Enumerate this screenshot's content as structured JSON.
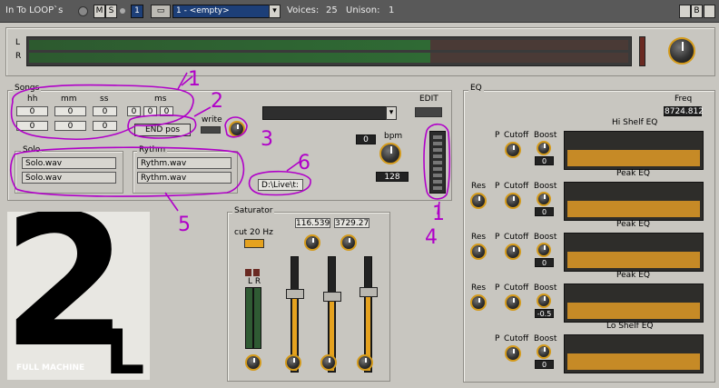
{
  "titlebar": {
    "device_name": "In To LOOP`s",
    "m_label": "M",
    "s_label": "S",
    "channel": "1",
    "preset": "1 - <empty>",
    "voices_label": "Voices:",
    "voices_value": "25",
    "unison_label": "Unison:",
    "unison_value": "1",
    "b_label": "B"
  },
  "meter": {
    "l_label": "L",
    "r_label": "R",
    "level": 0.67
  },
  "songs": {
    "title": "Songs",
    "col_hh": "hh",
    "col_mm": "mm",
    "col_ss": "ss",
    "col_ms": "ms",
    "row1": [
      "0",
      "0",
      "0",
      "0",
      "0",
      "0"
    ],
    "row2": [
      "0",
      "0",
      "0"
    ],
    "end_pos": "END pos",
    "write": "write",
    "edit": "EDIT",
    "bpm_label": "bpm",
    "bpm_small": "0",
    "bpm_value": "128",
    "path": "D:\\Live\\t:"
  },
  "solo": {
    "title": "Solo",
    "items": [
      "Solo.wav",
      "Solo.wav"
    ]
  },
  "rythm": {
    "title": "Rythm",
    "items": [
      "Rythm.wav",
      "Rythm.wav"
    ]
  },
  "logo": {
    "big": "2",
    "small": "L",
    "caption": "FULL MACHINE"
  },
  "saturator": {
    "title": "Saturator",
    "cut_label": "cut 20 Hz",
    "val1": "116.539",
    "val2": "3729.27",
    "lr_label": "L R"
  },
  "eq": {
    "title": "EQ",
    "freq_label": "Freq",
    "freq_value": "8724.812",
    "bands": [
      {
        "name": "Hi Shelf EQ",
        "res": "",
        "p": "P",
        "cutoff": "Cutoff",
        "boost": "Boost",
        "boost_val": "0"
      },
      {
        "name": "Peak EQ",
        "res": "Res",
        "p": "P",
        "cutoff": "Cutoff",
        "boost": "Boost",
        "boost_val": "0"
      },
      {
        "name": "Peak EQ",
        "res": "Res",
        "p": "P",
        "cutoff": "Cutoff",
        "boost": "Boost",
        "boost_val": "0"
      },
      {
        "name": "Peak EQ",
        "res": "Res",
        "p": "P",
        "cutoff": "Cutoff",
        "boost": "Boost",
        "boost_val": "-0.5"
      },
      {
        "name": "Lo Shelf EQ",
        "res": "",
        "p": "P",
        "cutoff": "Cutoff",
        "boost": "Boost",
        "boost_val": "0"
      }
    ]
  },
  "annotations": {
    "n1": "1",
    "n2": "2",
    "n3": "3",
    "n4": "4",
    "n5": "5",
    "n6": "6",
    "n7": "1"
  },
  "colors": {
    "accent": "#e5a21f",
    "annotation": "#b000c8",
    "titlebar": "#595959"
  }
}
